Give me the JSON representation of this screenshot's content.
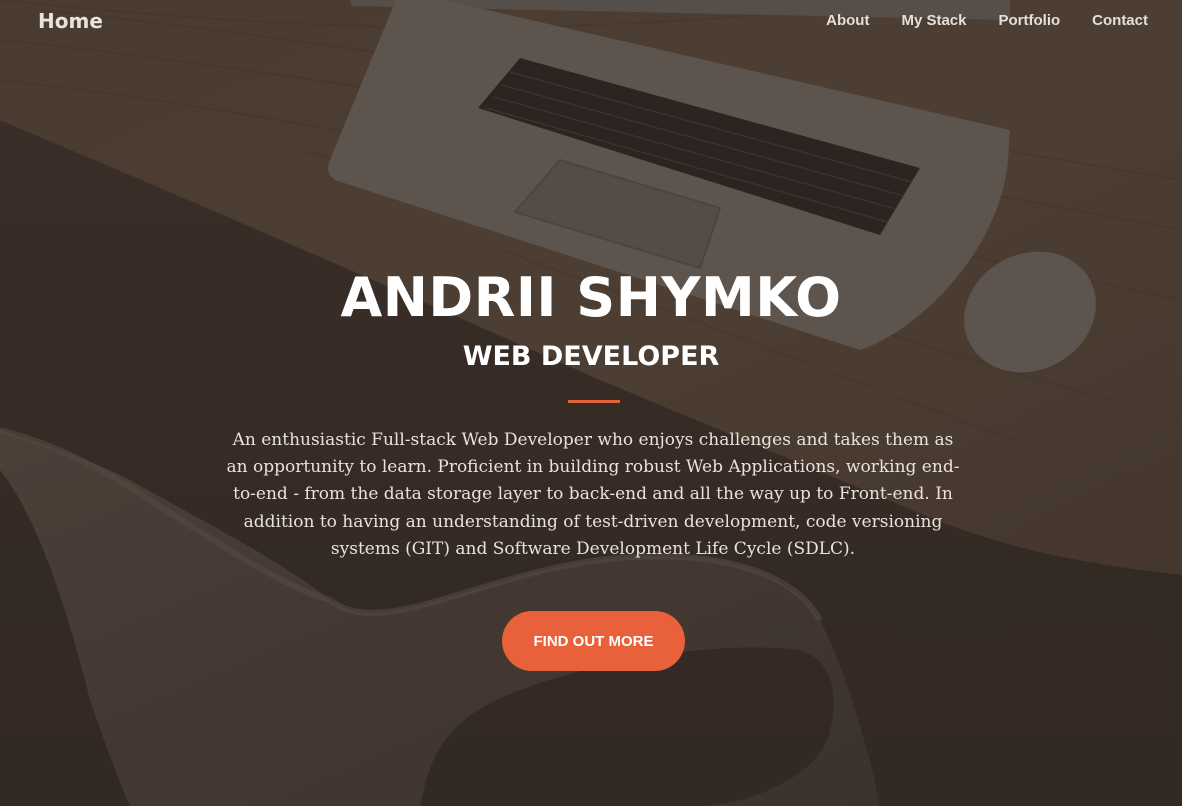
{
  "nav": {
    "brand": "Home",
    "links": [
      "About",
      "My Stack",
      "Portfolio",
      "Contact"
    ]
  },
  "hero": {
    "name": "ANDRII SHYMKO",
    "role": "WEB DEVELOPER",
    "summary": "An enthusiastic Full-stack Web Developer who enjoys challenges and takes them as an opportunity to learn. Proficient in building robust Web Applications, working end-to-end - from the data storage layer to back-end and all the way up to Front-end. In addition to having an understanding of test-driven development, code versioning systems (GIT) and Software Development Life Cycle (SDLC).",
    "cta_label": "FIND OUT MORE"
  },
  "colors": {
    "accent": "#e8613a",
    "overlay": "#3b322c",
    "text": "#ffffff"
  },
  "background": {
    "description_icon": "laptop-desk-photo"
  }
}
